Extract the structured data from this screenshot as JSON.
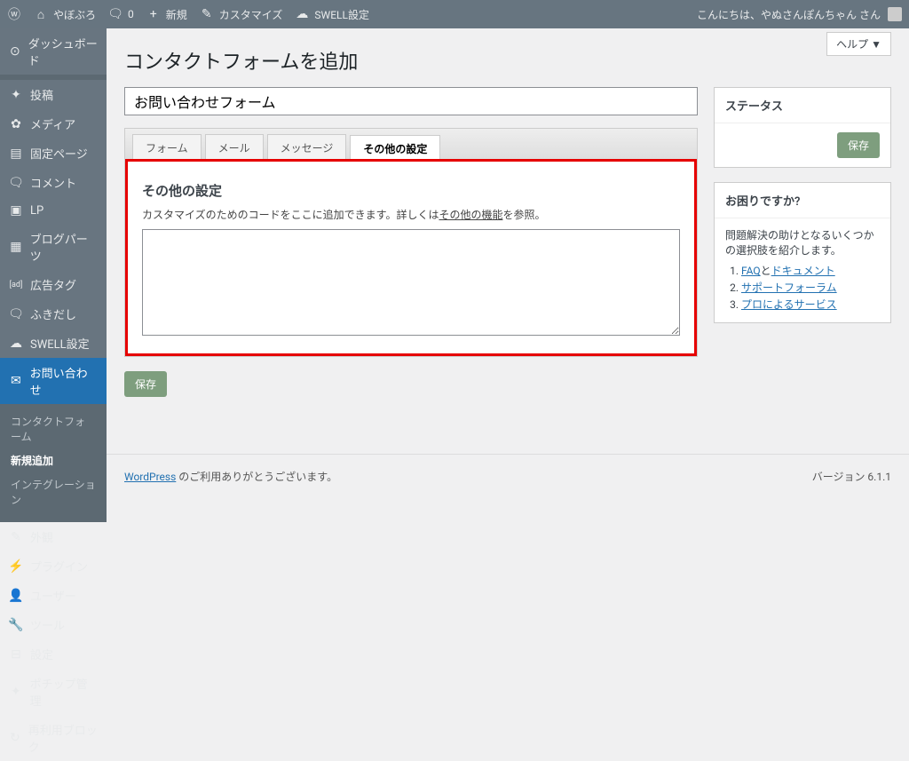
{
  "toolbar": {
    "site_name": "やぼぶろ",
    "comments": "0",
    "new_label": "新規",
    "customize": "カスタマイズ",
    "swell": "SWELL設定",
    "greeting": "こんにちは、やぬさんぽんちゃん さん"
  },
  "sidebar": {
    "items": [
      {
        "label": "ダッシュボード"
      },
      {
        "label": "投稿"
      },
      {
        "label": "メディア"
      },
      {
        "label": "固定ページ"
      },
      {
        "label": "コメント"
      },
      {
        "label": "LP"
      },
      {
        "label": "ブログパーツ"
      },
      {
        "label": "広告タグ"
      },
      {
        "label": "ふきだし"
      },
      {
        "label": "SWELL設定"
      },
      {
        "label": "お問い合わせ"
      }
    ],
    "sub": [
      {
        "label": "コンタクトフォーム"
      },
      {
        "label": "新規追加"
      },
      {
        "label": "インテグレーション"
      }
    ],
    "bottom": [
      {
        "label": "外観"
      },
      {
        "label": "プラグイン"
      },
      {
        "label": "ユーザー"
      },
      {
        "label": "ツール"
      },
      {
        "label": "設定"
      },
      {
        "label": "ポチップ管理"
      },
      {
        "label": "再利用ブロック"
      }
    ]
  },
  "page": {
    "title": "コンタクトフォームを追加",
    "title_input": "お問い合わせフォーム",
    "help": "ヘルプ ▼"
  },
  "tabs": {
    "t1": "フォーム",
    "t2": "メール",
    "t3": "メッセージ",
    "t4": "その他の設定"
  },
  "panel": {
    "heading": "その他の設定",
    "desc_pre": "カスタマイズのためのコードをここに追加できます。詳しくは",
    "desc_link": "その他の機能",
    "desc_post": "を参照。"
  },
  "buttons": {
    "save": "保存"
  },
  "side": {
    "status_h": "ステータス",
    "help_h": "お困りですか?",
    "help_desc": "問題解決の助けとなるいくつかの選択肢を紹介します。",
    "faq": "FAQ",
    "faq_and": "と",
    "docs": "ドキュメント",
    "forum": "サポートフォーラム",
    "pro": "プロによるサービス"
  },
  "footer": {
    "wp": "WordPress",
    "thanks": " のご利用ありがとうございます。",
    "version": "バージョン 6.1.1"
  }
}
